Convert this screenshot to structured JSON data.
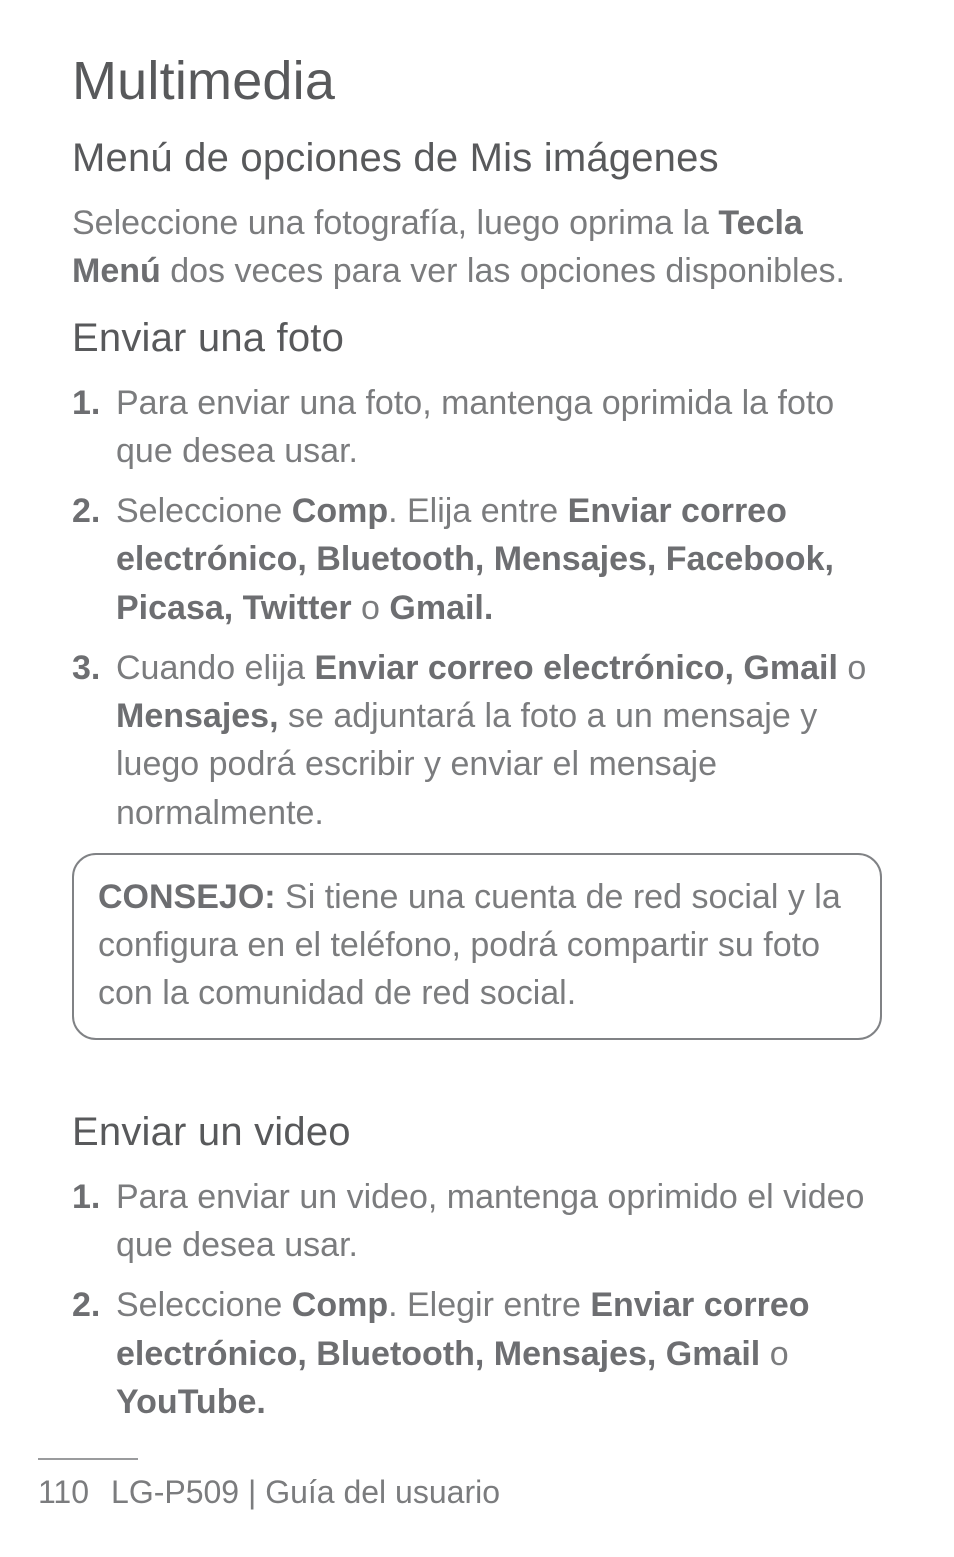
{
  "title": "Multimedia",
  "s1": {
    "heading": "Menú de opciones de Mis imágenes",
    "p_pre": "Seleccione una fotografía, luego oprima la ",
    "p_b1": "Tecla Menú",
    "p_post": " dos veces para ver las opciones disponibles."
  },
  "s2": {
    "heading": "Enviar una foto",
    "i1": {
      "num": "1.",
      "t": "Para enviar una foto, mantenga oprimida la foto que desea usar."
    },
    "i2": {
      "num": "2.",
      "pre": "Seleccione ",
      "b1": "Comp",
      "mid1": ". Elija entre ",
      "b2": "Enviar correo electrónico, Bluetooth, Mensajes, Facebook, Picasa, Twitter",
      "mid2": " o ",
      "b3": "Gmail."
    },
    "i3": {
      "num": "3.",
      "pre": "Cuando elija ",
      "b1": "Enviar correo electrónico, Gmail",
      "mid1": " o ",
      "b2": "Mensajes,",
      "post": " se adjuntará la foto a un mensaje y luego podrá escribir y enviar el mensaje normalmente."
    }
  },
  "tip": {
    "label": "CONSEJO:",
    "body": " Si tiene una cuenta de red social y la configura en el teléfono, podrá compartir su foto con la comunidad de red social."
  },
  "s3": {
    "heading": "Enviar un video",
    "i1": {
      "num": "1.",
      "t": "Para enviar un video, mantenga oprimido el video que desea usar."
    },
    "i2": {
      "num": "2.",
      "pre": "Seleccione ",
      "b1": "Comp",
      "mid1": ". Elegir entre ",
      "b2": "Enviar correo electrónico, Bluetooth, Mensajes, Gmail ",
      "mid2": " o ",
      "b3": "YouTube."
    }
  },
  "footer": {
    "page": "110",
    "doc": "LG-P509 | Guía del usuario"
  }
}
